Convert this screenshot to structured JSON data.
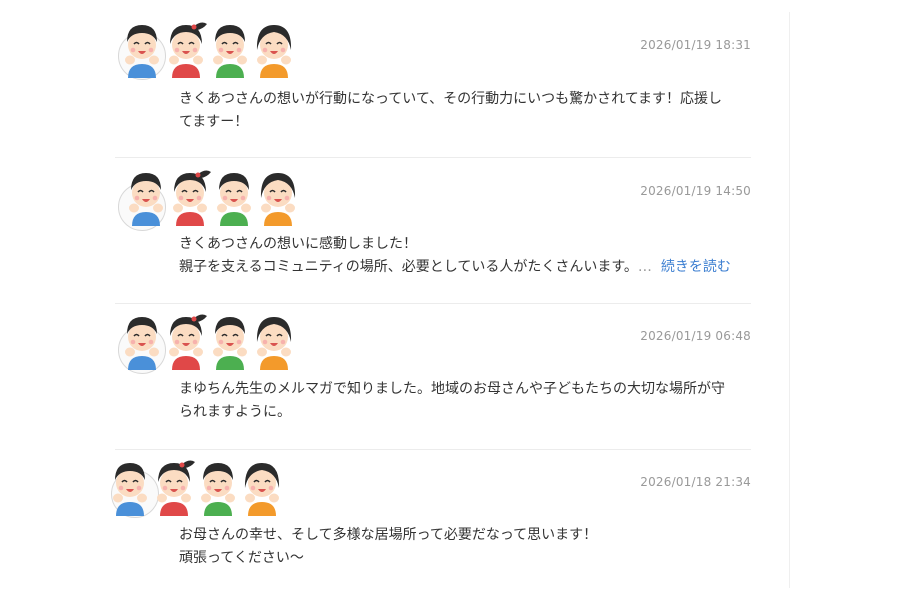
{
  "comments": [
    {
      "date": "2026/01/19 18:31",
      "lines": [
        "きくあつさんの想いが行動になっていて、その行動力にいつも驚かされてます！応援し",
        "てますー！"
      ]
    },
    {
      "date": "2026/01/19 14:50",
      "lines": [
        "きくあつさんの想いに感動しました！",
        "親子を支えるコミュニティの場所、必要としている人がたくさんいます。"
      ],
      "ellipsis": "…",
      "more_label": "続きを読む"
    },
    {
      "date": "2026/01/19 06:48",
      "lines": [
        "まゆちん先生のメルマガで知りました。地域のお母さんや子どもたちの大切な場所が守",
        "られますように。"
      ]
    },
    {
      "date": "2026/01/18 21:34",
      "lines": [
        "お母さんの幸せ、そして多様な居場所って必要だなって思います！",
        "頑張ってください〜"
      ]
    }
  ],
  "avatar": {
    "icon": "four-children-cheering-icon",
    "shirt_colors": [
      "#4a90d9",
      "#e04848",
      "#4caf50",
      "#f39a2b"
    ]
  }
}
